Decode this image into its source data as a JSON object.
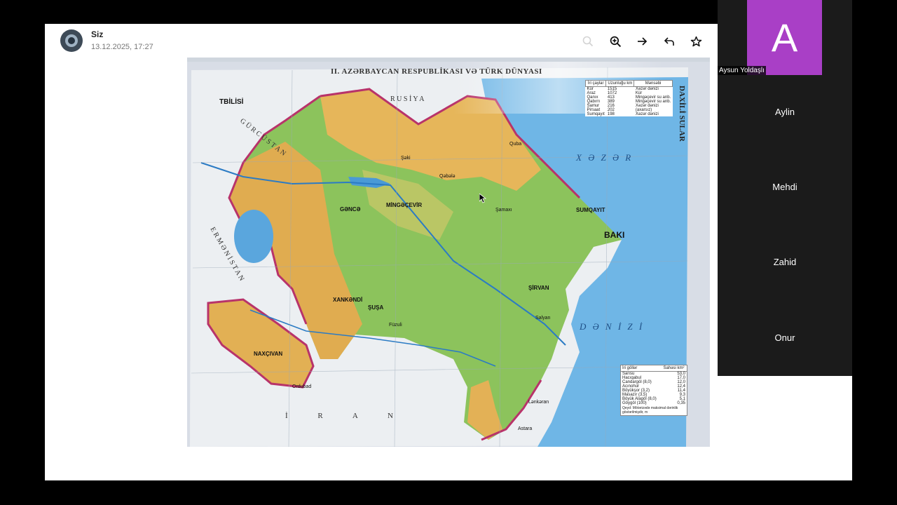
{
  "header": {
    "sender_name": "Siz",
    "timestamp": "13.12.2025, 17:27"
  },
  "toolbar": {
    "icons": [
      "zoom-out-icon",
      "zoom-in-icon",
      "forward-icon",
      "reply-icon",
      "star-icon"
    ]
  },
  "map": {
    "title": "II. AZƏRBAYCAN RESPUBLİKASI VƏ TÜRK DÜNYASI",
    "side_title": "DAXİLİ SULAR",
    "sea_label_1": "X Ə Z Ə R",
    "sea_label_2": "D Ə N İ Z İ",
    "country_labels": {
      "north": "R U S İ Y A",
      "georgia": "G Ü R C Ü S T A N",
      "armenia": "E R M Ə N İ S T A N",
      "iran": "İ R A N"
    },
    "cities": [
      {
        "name": "TBİLİSİ"
      },
      {
        "name": "BAKI"
      },
      {
        "name": "SUMQAYIT"
      },
      {
        "name": "GƏNCƏ"
      },
      {
        "name": "MİNGƏÇEVİR"
      },
      {
        "name": "NAXÇIVAN"
      },
      {
        "name": "ŞİRVAN"
      },
      {
        "name": "XANKƏNDİ"
      },
      {
        "name": "ŞUŞA"
      },
      {
        "name": "Lənkəran"
      },
      {
        "name": "Şamaxı"
      },
      {
        "name": "Qəbələ"
      },
      {
        "name": "Şəki"
      },
      {
        "name": "Quba"
      },
      {
        "name": "Salyan"
      },
      {
        "name": "Füzuli"
      },
      {
        "name": "Ordubad"
      },
      {
        "name": "Astara"
      }
    ],
    "rivers_table": {
      "headers": [
        "İri çaylar",
        "Uzunluğu km",
        "Mənsəbi"
      ],
      "rows": [
        [
          "Kür",
          "1515",
          "Xəzər dənizi"
        ],
        [
          "Araz",
          "1072",
          "Kür"
        ],
        [
          "Qanıx",
          "413",
          "Mingəçevir su anb."
        ],
        [
          "Qabırrı",
          "389",
          "Mingəçevir su anb."
        ],
        [
          "Samur",
          "216",
          "Xəzər dənizi"
        ],
        [
          "Pirsaat",
          "202",
          "(axarsız)"
        ],
        [
          "Sumqayıt",
          "198",
          "Xəzər dənizi"
        ]
      ]
    },
    "lakes_table": {
      "headers": [
        "İri göllər",
        "Sahəsi km²"
      ],
      "rows": [
        [
          "Sarısu",
          "53,0"
        ],
        [
          "Hacıqabul",
          "17,0"
        ],
        [
          "Candargöl (8,0)",
          "12,0"
        ],
        [
          "Acınohur",
          "12,4"
        ],
        [
          "Böyükşor (3,2)",
          "11,4"
        ],
        [
          "Masazır (3,5)",
          "9,3"
        ],
        [
          "Böyük Alagöl (8,0)",
          "5,1"
        ],
        [
          "Göygöl (100)",
          "0,35"
        ]
      ],
      "note": "Qeyd: Mötərizədə maksimal dərinlik göstərilmişdir, m"
    }
  },
  "participants": [
    {
      "initial": "A",
      "name": "Aysun Yoldaşlı",
      "color": "#a93fc6"
    },
    {
      "name": "Aylin"
    },
    {
      "name": "Mehdi"
    },
    {
      "name": "Zahid"
    },
    {
      "name": "Onur"
    }
  ]
}
